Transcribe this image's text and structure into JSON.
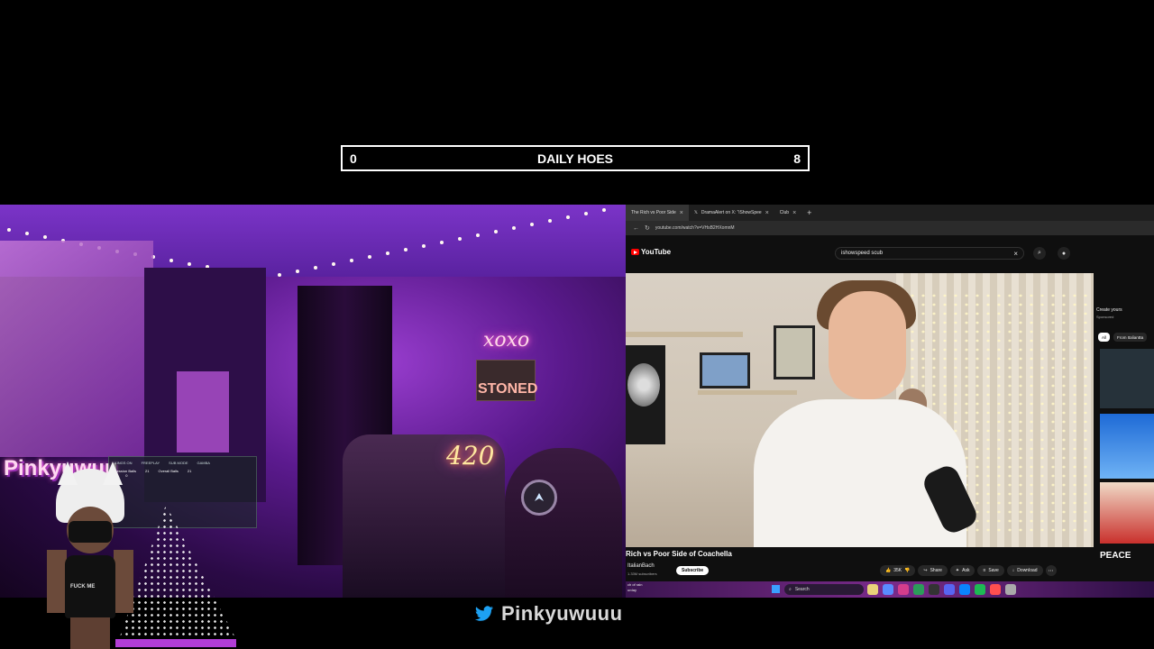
{
  "counter": {
    "left_value": "0",
    "title": "DAILY HOES",
    "right_value": "8"
  },
  "webcam": {
    "neon_sign_top": "xoxo",
    "sign_stoned": "STONED",
    "neon_sign_420": "420",
    "logo_text": "Pinkyuwuu",
    "stats_headers": [
      "KINGS ON",
      "FREEPLAY",
      "SUB MODE",
      "GAMBA"
    ],
    "stats_values": [
      "Session Balls",
      "21",
      "Overall Balls",
      "21",
      "0",
      "0"
    ]
  },
  "avatar": {
    "shirt_text": "FUCK ME"
  },
  "browser": {
    "tabs": [
      {
        "label": "The Rich vs Poor Side",
        "active": true
      },
      {
        "label": "DramaAlert on X: \"iShowSpee",
        "active": false
      },
      {
        "label": "Club",
        "active": false
      }
    ],
    "url": "youtube.com/watch?v=VHsB2HXomnM",
    "youtube": {
      "logo": "YouTube",
      "search_query": "ishowspeed scub",
      "video_title": "Rich vs Poor Side of Coachella",
      "channel": "ItalianBach",
      "subscribers": "1.33M subscribers",
      "subscribe_label": "Subscribe",
      "actions": [
        {
          "icon": "thumbs-up-icon",
          "label": "35K"
        },
        {
          "icon": "thumbs-down-icon",
          "label": ""
        },
        {
          "icon": "share-icon",
          "label": "Share"
        },
        {
          "icon": "sparkle-icon",
          "label": "Ask"
        },
        {
          "icon": "save-icon",
          "label": "Save"
        },
        {
          "icon": "download-icon",
          "label": "Download"
        }
      ],
      "sidebar": {
        "sponsor_title": "Create yours",
        "sponsor_sub": "Sponsored",
        "chips": [
          "All",
          "From ItalianBa"
        ],
        "thumb_text": "PEACE"
      }
    },
    "taskbar": {
      "weather_line1": "ch of rain",
      "weather_line2": "urday",
      "search_label": "Search"
    }
  },
  "social": {
    "twitter_handle": "Pinkyuwuuu"
  },
  "colors": {
    "counter_border": "#ffffff",
    "neon_pink": "#ff4fc3",
    "youtube_red": "#ff0000",
    "twitter_blue": "#1da1f2",
    "dot_bar": "#b23dd6"
  }
}
